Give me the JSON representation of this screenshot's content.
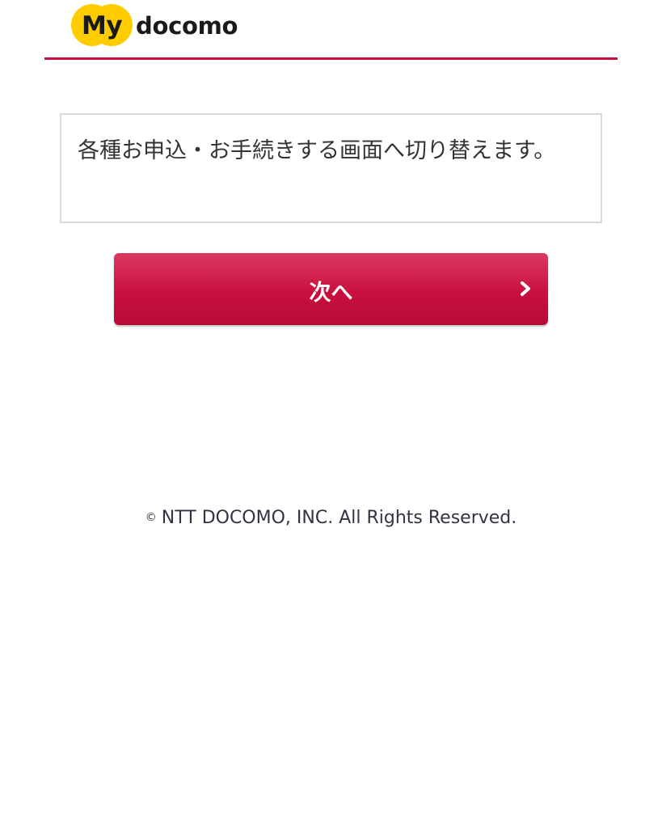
{
  "header": {
    "logo_my": "My",
    "logo_docomo": "docomo",
    "accent_color": "#c8103e",
    "logo_color": "#ffcc00"
  },
  "notice": {
    "text": "各種お申込・お手続きする画面へ切り替えます。"
  },
  "next_button": {
    "label": "次へ",
    "icon": "chevron-right-icon",
    "color": "#c8103e"
  },
  "footer": {
    "copyright_symbol": "©",
    "copyright_text": "NTT DOCOMO, INC. All Rights Reserved."
  }
}
